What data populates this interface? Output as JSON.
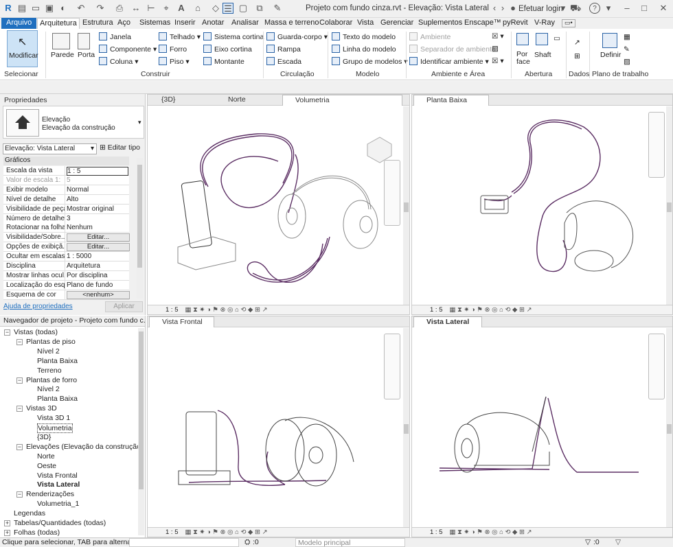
{
  "window": {
    "title": "Projeto com fundo cinza.rvt - Elevação: Vista Lateral",
    "login": "Efetuar login"
  },
  "ribbon_tabs": [
    "Arquivo",
    "Arquitetura",
    "Estrutura",
    "Aço",
    "Sistemas",
    "Inserir",
    "Anotar",
    "Analisar",
    "Massa e terreno",
    "Colaborar",
    "Vista",
    "Gerenciar",
    "Suplementos",
    "Enscape™",
    "pyRevit",
    "V-Ray"
  ],
  "ribbon": {
    "modify": "Modificar",
    "select": "Selecionar",
    "wall": "Parede",
    "door": "Porta",
    "window": "Janela",
    "component": "Componente",
    "column": "Coluna",
    "roof": "Telhado",
    "ceiling": "Forro",
    "floor": "Piso",
    "curtain_system": "Sistema cortina",
    "curtain_grid": "Eixo  cortina",
    "mullion": "Montante",
    "railing": "Guarda-corpo",
    "ramp": "Rampa",
    "stair": "Escada",
    "model_text": "Texto do  modelo",
    "model_line": "Linha do  modelo",
    "model_group": "Grupo de modelos",
    "room": "Ambiente",
    "room_separator": "Separador  de ambiente",
    "tag_room": "Identificar  ambiente",
    "by_face": "Por face",
    "shaft": "Shaft",
    "set": "Definir",
    "panels": {
      "construct": "Construir",
      "circulation": "Circulação",
      "model": "Modelo",
      "room_area": "Ambiente e Área",
      "opening": "Abertura",
      "datum": "Dados",
      "workplane": "Plano de trabalho"
    }
  },
  "properties": {
    "header": "Propriedades",
    "type_name": "Elevação",
    "type_sub": "Elevação da construção",
    "instance": "Elevação: Vista Lateral",
    "edit_type": "Editar tipo",
    "group": "Gráficos",
    "rows": [
      {
        "k": "Escala da vista",
        "v": "1 : 5"
      },
      {
        "k": "Valor de escala   1:",
        "v": "5"
      },
      {
        "k": "Exibir modelo",
        "v": "Normal"
      },
      {
        "k": "Nível de detalhe",
        "v": "Alto"
      },
      {
        "k": "Visibilidade de peças",
        "v": "Mostrar original"
      },
      {
        "k": "Número de detalhe",
        "v": "3"
      },
      {
        "k": "Rotacionar na folha",
        "v": "Nenhum"
      },
      {
        "k": "Visibilidade/Sobre...",
        "v": "Editar..."
      },
      {
        "k": "Opções de exibiçã...",
        "v": "Editar..."
      },
      {
        "k": "Ocultar em escalas...",
        "v": "1 : 5000"
      },
      {
        "k": "Disciplina",
        "v": "Arquitetura"
      },
      {
        "k": "Mostrar linhas ocul...",
        "v": "Por disciplina"
      },
      {
        "k": "Localização do esq...",
        "v": "Plano de fundo"
      },
      {
        "k": "Esquema de cor",
        "v": "<nenhum>"
      }
    ],
    "help": "Ajuda de propriedades",
    "apply": "Aplicar"
  },
  "navigator": {
    "header": "Navegador de projeto - Projeto com fundo c...",
    "items": [
      {
        "t": "Vistas (todas)",
        "lvl": 0
      },
      {
        "t": "Plantas de piso",
        "lvl": 1
      },
      {
        "t": "Nível 2",
        "lvl": 2
      },
      {
        "t": "Planta Baixa",
        "lvl": 2
      },
      {
        "t": "Terreno",
        "lvl": 2
      },
      {
        "t": "Plantas de forro",
        "lvl": 1
      },
      {
        "t": "Nível 2",
        "lvl": 2
      },
      {
        "t": "Planta Baixa",
        "lvl": 2
      },
      {
        "t": "Vistas 3D",
        "lvl": 1
      },
      {
        "t": "Vista 3D 1",
        "lvl": 2
      },
      {
        "t": "Volumetria",
        "lvl": 2
      },
      {
        "t": "{3D}",
        "lvl": 2
      },
      {
        "t": "Elevações (Elevação da construção)",
        "lvl": 1
      },
      {
        "t": "Norte",
        "lvl": 2
      },
      {
        "t": "Oeste",
        "lvl": 2
      },
      {
        "t": "Vista Frontal",
        "lvl": 2
      },
      {
        "t": "Vista Lateral",
        "lvl": 2
      },
      {
        "t": "Renderizações",
        "lvl": 1
      },
      {
        "t": "Volumetria_1",
        "lvl": 2
      },
      {
        "t": "Legendas",
        "lvl": 0
      },
      {
        "t": "Tabelas/Quantidades (todas)",
        "lvl": 0
      },
      {
        "t": "Folhas (todas)",
        "lvl": 0
      }
    ]
  },
  "views": {
    "tl_tabs": [
      "{3D}",
      "Norte",
      "Volumetria"
    ],
    "tr_tab": "Planta Baixa",
    "bl_tab": "Vista Frontal",
    "br_tab": "Vista Lateral",
    "scale": "1 : 5"
  },
  "status": {
    "hint": "Clique para selecionar, TAB para alternat",
    "workset": ":0",
    "model": "Modelo principal",
    "count": ":0"
  },
  "colors": {
    "accent": "#1f6fbf",
    "cable": "#5b2e63",
    "select_bg": "#cde3f6"
  }
}
